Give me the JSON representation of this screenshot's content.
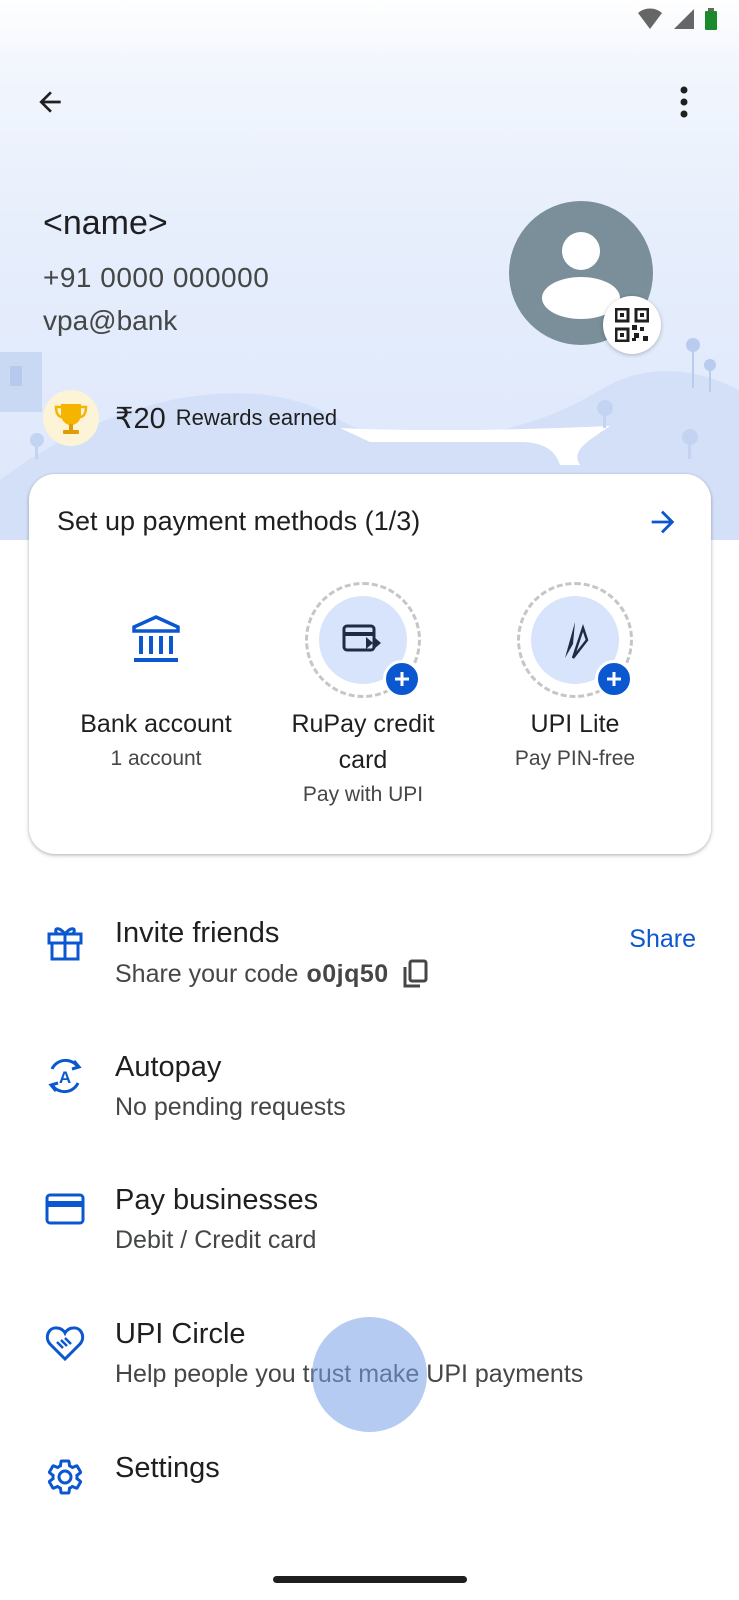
{
  "profile": {
    "name": "<name>",
    "phone": "+91 0000 000000",
    "vpa": "vpa@bank"
  },
  "rewards": {
    "amount": "₹20",
    "label": "Rewards earned"
  },
  "payment_setup": {
    "title": "Set up payment methods (1/3)",
    "methods": [
      {
        "label": "Bank account",
        "sub": "1 account"
      },
      {
        "label": "RuPay credit card",
        "sub": "Pay with UPI"
      },
      {
        "label": "UPI Lite",
        "sub": "Pay PIN-free"
      }
    ]
  },
  "list": {
    "invite": {
      "title": "Invite friends",
      "sub": "Share your code",
      "code": "o0jq50",
      "action": "Share"
    },
    "autopay": {
      "title": "Autopay",
      "sub": "No pending requests"
    },
    "business": {
      "title": "Pay businesses",
      "sub": "Debit / Credit card"
    },
    "circle": {
      "title": "UPI Circle",
      "sub": "Help people you trust make UPI payments"
    },
    "settings": {
      "title": "Settings"
    }
  },
  "colors": {
    "accent": "#0b57d0",
    "avatar_bg": "#7a8f9a",
    "text_primary": "#1f1f1f",
    "text_secondary": "#444746"
  }
}
